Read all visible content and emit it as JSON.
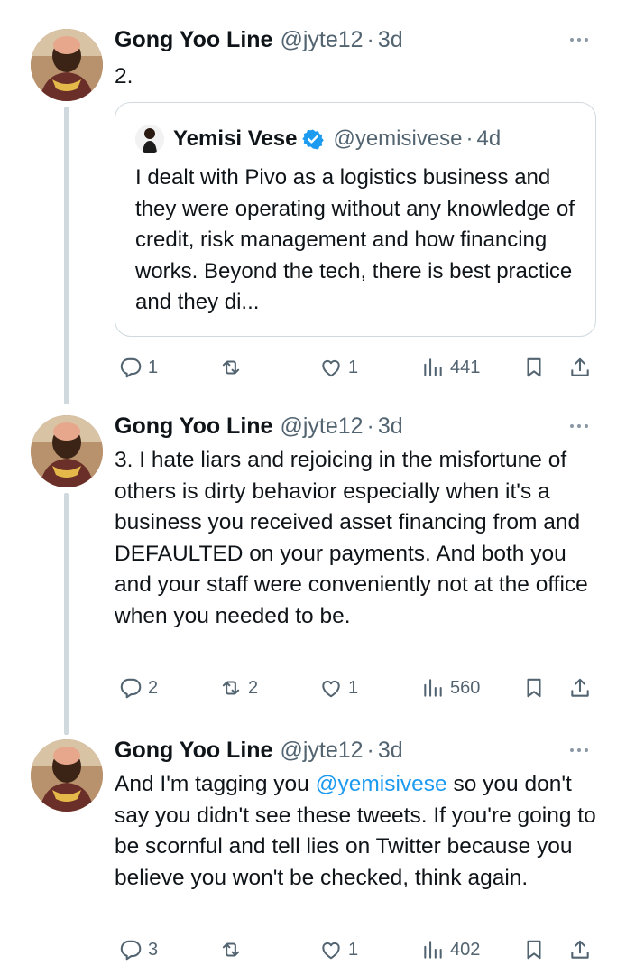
{
  "tweets": [
    {
      "author": {
        "name": "Gong Yoo Line",
        "handle": "@jyte12",
        "time": "3d"
      },
      "text": "2.",
      "quote": {
        "author": {
          "name": "Yemisi Vese",
          "handle": "@yemisivese",
          "time": "4d",
          "verified": true
        },
        "text": "I dealt with Pivo as a logistics business and they were operating without any knowledge of credit, risk management and how financing works. Beyond the tech, there is best practice and they di..."
      },
      "stats": {
        "replies": "1",
        "retweets": "",
        "likes": "1",
        "views": "441"
      }
    },
    {
      "author": {
        "name": "Gong Yoo Line",
        "handle": "@jyte12",
        "time": "3d"
      },
      "text": "3. I hate liars and rejoicing in the misfortune of others is dirty behavior especially when it's a business you received asset financing from and DEFAULTED on your payments. And both you and your staff were conveniently not at the office when you needed to be.",
      "stats": {
        "replies": "2",
        "retweets": "2",
        "likes": "1",
        "views": "560"
      }
    },
    {
      "author": {
        "name": "Gong Yoo Line",
        "handle": "@jyte12",
        "time": "3d"
      },
      "text_before": "And I'm tagging you ",
      "mention": "@yemisivese",
      "text_after": " so you don't say you didn't see these tweets. If you're going to be scornful and tell lies on Twitter because you believe you won't be checked, think again.",
      "stats": {
        "replies": "3",
        "retweets": "",
        "likes": "1",
        "views": "402"
      }
    }
  ],
  "colors": {
    "accent": "#1d9bf0",
    "secondary_text": "#536471",
    "border": "#cfd9de"
  },
  "icons": [
    "reply-icon",
    "retweet-icon",
    "like-icon",
    "views-icon",
    "bookmark-icon",
    "share-icon",
    "more-icon",
    "verified-icon"
  ]
}
